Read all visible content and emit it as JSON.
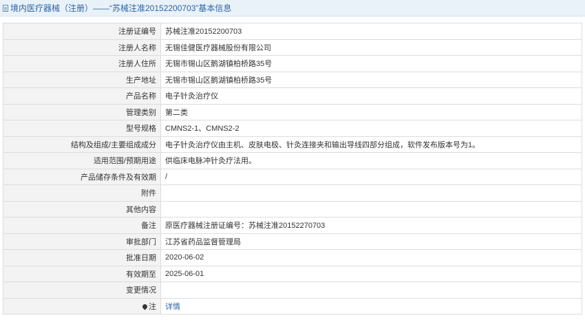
{
  "header": {
    "title": "境内医疗器械（注册）——“苏械注准20152200703”基本信息"
  },
  "rows": [
    {
      "label": "注册证编号",
      "value": "苏械注准20152200703"
    },
    {
      "label": "注册人名称",
      "value": "无锡佳健医疗器械股份有限公司"
    },
    {
      "label": "注册人住所",
      "value": "无锡市锡山区鹅湖镇柏桥路35号"
    },
    {
      "label": "生产地址",
      "value": "无锡市锡山区鹅湖镇柏桥路35号"
    },
    {
      "label": "产品名称",
      "value": "电子针灸治疗仪"
    },
    {
      "label": "管理类别",
      "value": "第二类"
    },
    {
      "label": "型号规格",
      "value": "CMNS2-1、CMNS2-2"
    },
    {
      "label": "结构及组成/主要组成成分",
      "value": "电子针灸治疗仪由主机、皮肤电极、针灸连接夹和输出导线四部分组成，软件发布版本号为1。"
    },
    {
      "label": "适用范围/预期用途",
      "value": "供临床电脉冲针灸疗法用。"
    },
    {
      "label": "产品储存条件及有效期",
      "value": "/"
    },
    {
      "label": "附件",
      "value": ""
    },
    {
      "label": "其他内容",
      "value": ""
    },
    {
      "label": "备注",
      "value": "原医疗器械注册证编号：苏械注准20152270703"
    },
    {
      "label": "审批部门",
      "value": "江苏省药品监督管理局"
    },
    {
      "label": "批准日期",
      "value": "2020-06-02"
    },
    {
      "label": "有效期至",
      "value": "2025-06-01"
    },
    {
      "label": "变更情况",
      "value": ""
    }
  ],
  "note": {
    "label": "注",
    "link": "详情"
  }
}
